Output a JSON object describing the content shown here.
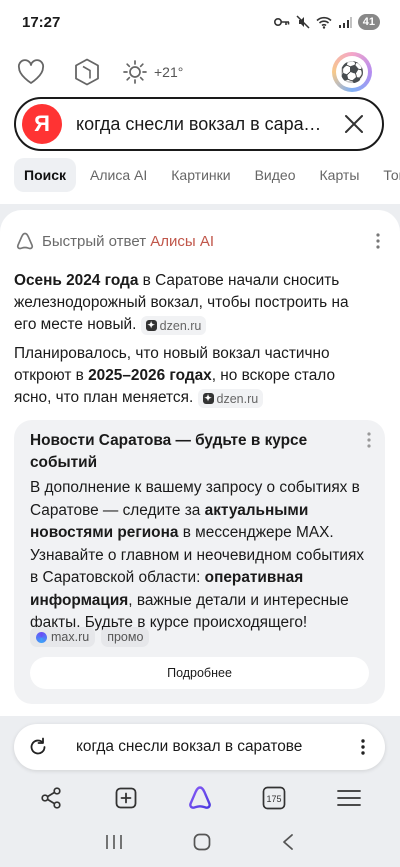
{
  "status_bar": {
    "time": "17:27",
    "battery": "41"
  },
  "header": {
    "weather": "+21°",
    "search_logo": "Я",
    "search_query": "когда снесли вокзал в сарат…",
    "tabs": [
      {
        "label": "Поиск",
        "active": true
      },
      {
        "label": "Алиса AI",
        "active": false
      },
      {
        "label": "Картинки",
        "active": false
      },
      {
        "label": "Видео",
        "active": false
      },
      {
        "label": "Карты",
        "active": false
      },
      {
        "label": "Тов",
        "active": false
      }
    ]
  },
  "answer": {
    "title_prefix": "Быстрый ответ ",
    "title_ai": "Алисы AI",
    "p1_bold": "Осень 2024 года",
    "p1_text": " в Саратове начали сносить железнодорожный вокзал, чтобы построить на его месте новый.",
    "p1_source": "dzen.ru",
    "p2_text_a": "Планировалось, что новый вокзал частично откроют в ",
    "p2_bold": "2025–2026 годах",
    "p2_text_b": ", но вскоре стало ясно, что план меняется.",
    "p2_source": "dzen.ru"
  },
  "promo": {
    "title": "Новости Саратова — будьте в курсе событий",
    "body_a": "В дополнение к вашему запросу о событиях в Саратове — следите за ",
    "body_bold_a": "актуальными новостями региона",
    "body_b": " в мессенджере MAX. Узнавайте о главном и неочевидном событиях в Саратовской области: ",
    "body_bold_b": "оперативная информация",
    "body_c": ", важные детали и интересные факты. Будьте в курсе происходящего!",
    "tag_source": "max.ru",
    "tag_promo": "промо",
    "button": "Подробнее"
  },
  "bottom": {
    "query": "когда снесли вокзал в саратове",
    "tabs_count": "175"
  },
  "colors": {
    "accent_red": "#ff3333",
    "alice_purple": "#6b4df5",
    "ai_label": "#c0564a"
  }
}
